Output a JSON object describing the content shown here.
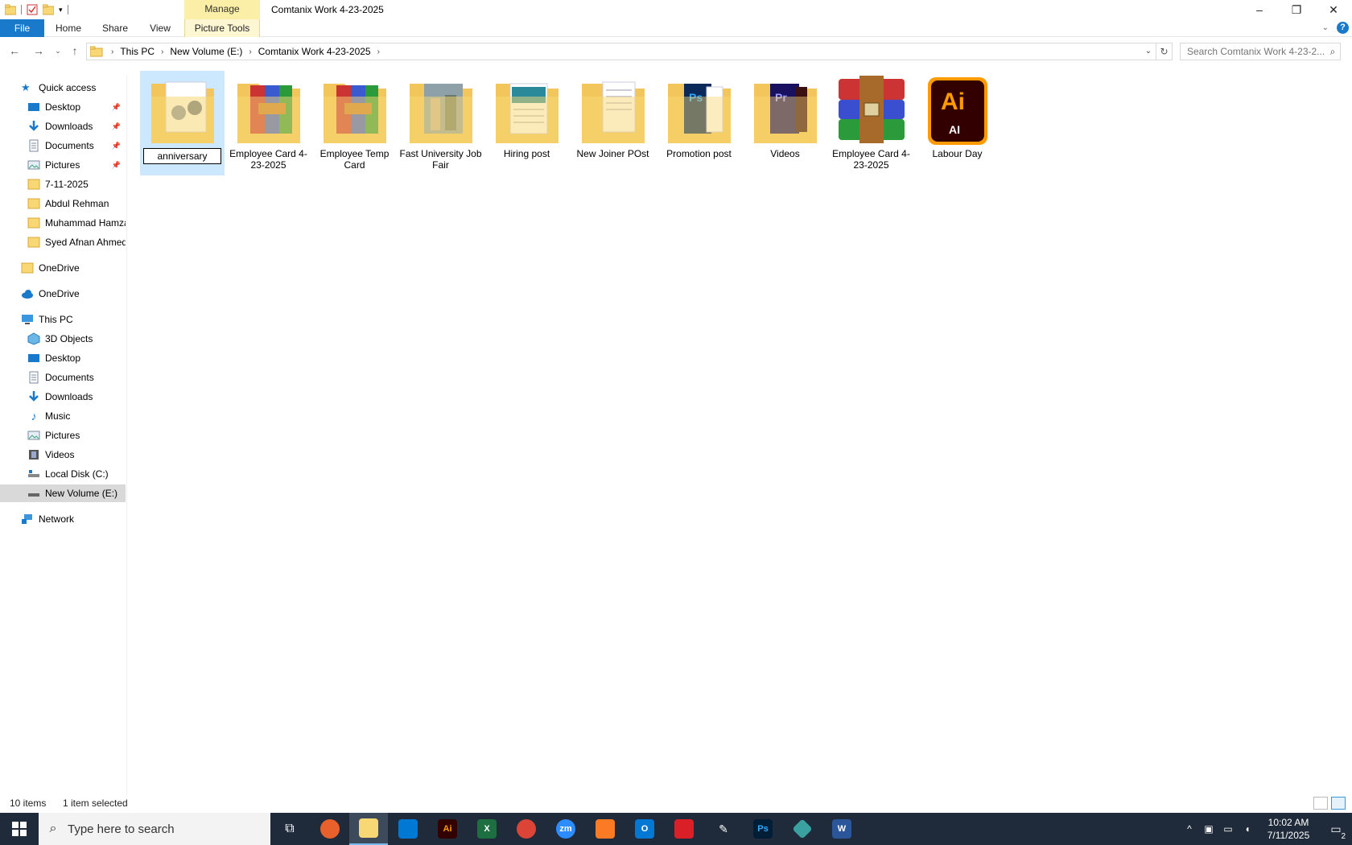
{
  "window": {
    "title": "Comtanix Work 4-23-2025",
    "context_tab": "Manage",
    "controls": [
      "–",
      "❐",
      "✕"
    ]
  },
  "ribbon": {
    "tabs": [
      "File",
      "Home",
      "Share",
      "View",
      "Picture Tools"
    ],
    "help": "?"
  },
  "address": {
    "crumbs": [
      "This PC",
      "New Volume (E:)",
      "Comtanix Work 4-23-2025"
    ],
    "search_placeholder": "Search Comtanix Work 4-23-2..."
  },
  "sidebar": {
    "quick_access": "Quick access",
    "qa_items": [
      "Desktop",
      "Downloads",
      "Documents",
      "Pictures",
      "7-11-2025",
      "Abdul Rehman",
      "Muhammad Hamza",
      "Syed Afnan Ahmed"
    ],
    "onedrive1": "OneDrive",
    "onedrive2": "OneDrive",
    "this_pc": "This PC",
    "pc_items": [
      "3D Objects",
      "Desktop",
      "Documents",
      "Downloads",
      "Music",
      "Pictures",
      "Videos",
      "Local Disk (C:)",
      "New Volume (E:)"
    ],
    "network": "Network"
  },
  "files": [
    {
      "name": "anniversary",
      "kind": "folder-photo",
      "selected": true
    },
    {
      "name": "Employee Card 4-23-2025",
      "kind": "folder-rar"
    },
    {
      "name": "Employee Temp Card",
      "kind": "folder-rar"
    },
    {
      "name": "Fast University Job Fair",
      "kind": "folder-photo"
    },
    {
      "name": "Hiring post",
      "kind": "folder-doc"
    },
    {
      "name": "New Joiner POst",
      "kind": "folder-doc"
    },
    {
      "name": "Promotion post",
      "kind": "folder-psd"
    },
    {
      "name": "Videos",
      "kind": "folder-pr"
    },
    {
      "name": "Employee Card 4-23-2025",
      "kind": "rar-archive"
    },
    {
      "name": "Labour Day",
      "kind": "ai-file"
    }
  ],
  "status": {
    "items": "10 items",
    "selected": "1 item selected"
  },
  "taskbar": {
    "search_placeholder": "Type here to search",
    "time": "10:02 AM",
    "date": "7/11/2025",
    "notifications": "2"
  },
  "colors": {
    "accent": "#1979ca",
    "selection": "#cce8ff",
    "folder": "#f8d775",
    "taskbar": "#1f2b3a"
  }
}
